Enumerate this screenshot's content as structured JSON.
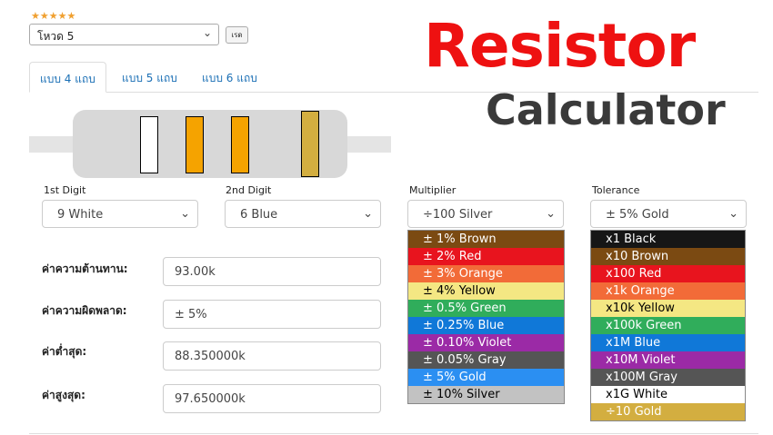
{
  "rating": {
    "stars": "★★★★★"
  },
  "mode": {
    "selected": "โหวด 5",
    "go_label": "เรด"
  },
  "title": {
    "line1": "Resistor",
    "line2": "Calculator"
  },
  "tabs": [
    {
      "label": "แบบ 4 แถบ",
      "active": true
    },
    {
      "label": "แบบ 5 แถบ",
      "active": false
    },
    {
      "label": "แบบ 6 แถบ",
      "active": false
    }
  ],
  "bands": {
    "colors": [
      "#ffffff",
      "#f5a300",
      "#f5a300",
      "#d3ae40"
    ]
  },
  "selectors": {
    "first": {
      "label": "1st Digit",
      "value": "9 White"
    },
    "second": {
      "label": "2nd Digit",
      "value": "6 Blue"
    },
    "multiplier": {
      "label": "Multiplier",
      "value": "÷100 Silver"
    },
    "tolerance": {
      "label": "Tolerance",
      "value": "± 5% Gold"
    }
  },
  "results": {
    "resistance": {
      "label": "ค่าความต้านทาน:",
      "value": "93.00k"
    },
    "tolerance": {
      "label": "ค่าความผิดพลาด:",
      "value": "± 5%"
    },
    "min": {
      "label": "ค่าต่ำสุด:",
      "value": "88.350000k"
    },
    "max": {
      "label": "ค่าสูงสุด:",
      "value": "97.650000k"
    }
  },
  "multiplier_options": [
    {
      "label": "± 1% Brown",
      "color": "#7b4a12"
    },
    {
      "label": "± 2% Red",
      "color": "#e8141e"
    },
    {
      "label": "± 3% Orange",
      "color": "#f26b38"
    },
    {
      "label": "± 4% Yellow",
      "color": "#f4e783"
    },
    {
      "label": "± 0.5% Green",
      "color": "#30ad5b"
    },
    {
      "label": "± 0.25% Blue",
      "color": "#1078d8"
    },
    {
      "label": "± 0.10% Violet",
      "color": "#9b2aa6"
    },
    {
      "label": "± 0.05% Gray",
      "color": "#555555"
    },
    {
      "label": "± 5% Gold",
      "color": "#2b8ff2"
    },
    {
      "label": "± 10% Silver",
      "color": "#c2c2c2"
    }
  ],
  "tolerance_options": [
    {
      "label": "x1 Black",
      "color": "#161616"
    },
    {
      "label": "x10 Brown",
      "color": "#7b4a12"
    },
    {
      "label": "x100 Red",
      "color": "#e8141e"
    },
    {
      "label": "x1k Orange",
      "color": "#f26b38"
    },
    {
      "label": "x10k Yellow",
      "color": "#f4e783"
    },
    {
      "label": "x100k Green",
      "color": "#30ad5b"
    },
    {
      "label": "x1M Blue",
      "color": "#1078d8"
    },
    {
      "label": "x10M Violet",
      "color": "#9b2aa6"
    },
    {
      "label": "x100M Gray",
      "color": "#555555"
    },
    {
      "label": "x1G White",
      "color": "#ffffff"
    },
    {
      "label": "÷10 Gold",
      "color": "#d3ae40"
    }
  ]
}
